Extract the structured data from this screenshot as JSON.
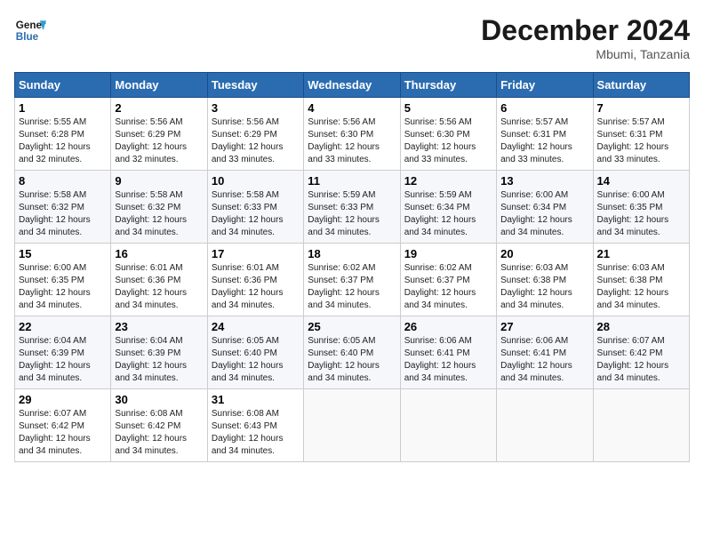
{
  "header": {
    "logo_line1": "General",
    "logo_line2": "Blue",
    "month": "December 2024",
    "location": "Mbumi, Tanzania"
  },
  "columns": [
    "Sunday",
    "Monday",
    "Tuesday",
    "Wednesday",
    "Thursday",
    "Friday",
    "Saturday"
  ],
  "weeks": [
    [
      {
        "day": "1",
        "info": "Sunrise: 5:55 AM\nSunset: 6:28 PM\nDaylight: 12 hours\nand 32 minutes."
      },
      {
        "day": "2",
        "info": "Sunrise: 5:56 AM\nSunset: 6:29 PM\nDaylight: 12 hours\nand 32 minutes."
      },
      {
        "day": "3",
        "info": "Sunrise: 5:56 AM\nSunset: 6:29 PM\nDaylight: 12 hours\nand 33 minutes."
      },
      {
        "day": "4",
        "info": "Sunrise: 5:56 AM\nSunset: 6:30 PM\nDaylight: 12 hours\nand 33 minutes."
      },
      {
        "day": "5",
        "info": "Sunrise: 5:56 AM\nSunset: 6:30 PM\nDaylight: 12 hours\nand 33 minutes."
      },
      {
        "day": "6",
        "info": "Sunrise: 5:57 AM\nSunset: 6:31 PM\nDaylight: 12 hours\nand 33 minutes."
      },
      {
        "day": "7",
        "info": "Sunrise: 5:57 AM\nSunset: 6:31 PM\nDaylight: 12 hours\nand 33 minutes."
      }
    ],
    [
      {
        "day": "8",
        "info": "Sunrise: 5:58 AM\nSunset: 6:32 PM\nDaylight: 12 hours\nand 34 minutes."
      },
      {
        "day": "9",
        "info": "Sunrise: 5:58 AM\nSunset: 6:32 PM\nDaylight: 12 hours\nand 34 minutes."
      },
      {
        "day": "10",
        "info": "Sunrise: 5:58 AM\nSunset: 6:33 PM\nDaylight: 12 hours\nand 34 minutes."
      },
      {
        "day": "11",
        "info": "Sunrise: 5:59 AM\nSunset: 6:33 PM\nDaylight: 12 hours\nand 34 minutes."
      },
      {
        "day": "12",
        "info": "Sunrise: 5:59 AM\nSunset: 6:34 PM\nDaylight: 12 hours\nand 34 minutes."
      },
      {
        "day": "13",
        "info": "Sunrise: 6:00 AM\nSunset: 6:34 PM\nDaylight: 12 hours\nand 34 minutes."
      },
      {
        "day": "14",
        "info": "Sunrise: 6:00 AM\nSunset: 6:35 PM\nDaylight: 12 hours\nand 34 minutes."
      }
    ],
    [
      {
        "day": "15",
        "info": "Sunrise: 6:00 AM\nSunset: 6:35 PM\nDaylight: 12 hours\nand 34 minutes."
      },
      {
        "day": "16",
        "info": "Sunrise: 6:01 AM\nSunset: 6:36 PM\nDaylight: 12 hours\nand 34 minutes."
      },
      {
        "day": "17",
        "info": "Sunrise: 6:01 AM\nSunset: 6:36 PM\nDaylight: 12 hours\nand 34 minutes."
      },
      {
        "day": "18",
        "info": "Sunrise: 6:02 AM\nSunset: 6:37 PM\nDaylight: 12 hours\nand 34 minutes."
      },
      {
        "day": "19",
        "info": "Sunrise: 6:02 AM\nSunset: 6:37 PM\nDaylight: 12 hours\nand 34 minutes."
      },
      {
        "day": "20",
        "info": "Sunrise: 6:03 AM\nSunset: 6:38 PM\nDaylight: 12 hours\nand 34 minutes."
      },
      {
        "day": "21",
        "info": "Sunrise: 6:03 AM\nSunset: 6:38 PM\nDaylight: 12 hours\nand 34 minutes."
      }
    ],
    [
      {
        "day": "22",
        "info": "Sunrise: 6:04 AM\nSunset: 6:39 PM\nDaylight: 12 hours\nand 34 minutes."
      },
      {
        "day": "23",
        "info": "Sunrise: 6:04 AM\nSunset: 6:39 PM\nDaylight: 12 hours\nand 34 minutes."
      },
      {
        "day": "24",
        "info": "Sunrise: 6:05 AM\nSunset: 6:40 PM\nDaylight: 12 hours\nand 34 minutes."
      },
      {
        "day": "25",
        "info": "Sunrise: 6:05 AM\nSunset: 6:40 PM\nDaylight: 12 hours\nand 34 minutes."
      },
      {
        "day": "26",
        "info": "Sunrise: 6:06 AM\nSunset: 6:41 PM\nDaylight: 12 hours\nand 34 minutes."
      },
      {
        "day": "27",
        "info": "Sunrise: 6:06 AM\nSunset: 6:41 PM\nDaylight: 12 hours\nand 34 minutes."
      },
      {
        "day": "28",
        "info": "Sunrise: 6:07 AM\nSunset: 6:42 PM\nDaylight: 12 hours\nand 34 minutes."
      }
    ],
    [
      {
        "day": "29",
        "info": "Sunrise: 6:07 AM\nSunset: 6:42 PM\nDaylight: 12 hours\nand 34 minutes."
      },
      {
        "day": "30",
        "info": "Sunrise: 6:08 AM\nSunset: 6:42 PM\nDaylight: 12 hours\nand 34 minutes."
      },
      {
        "day": "31",
        "info": "Sunrise: 6:08 AM\nSunset: 6:43 PM\nDaylight: 12 hours\nand 34 minutes."
      },
      null,
      null,
      null,
      null
    ]
  ]
}
